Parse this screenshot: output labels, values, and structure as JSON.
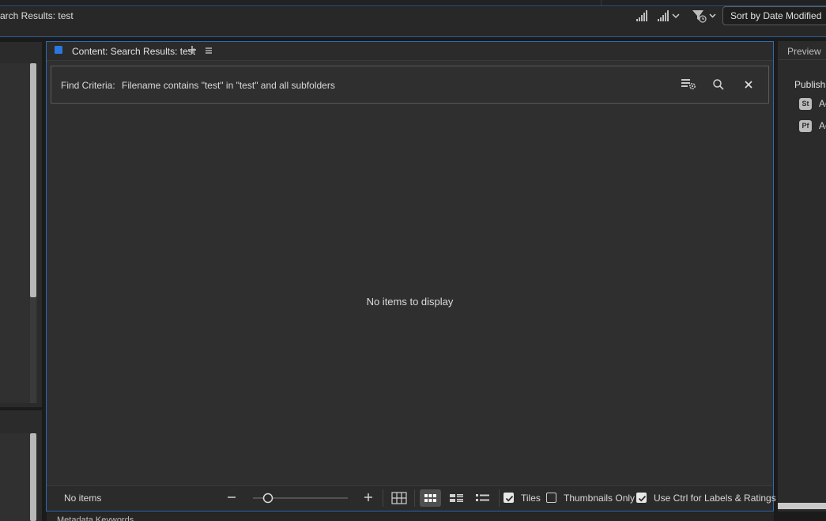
{
  "path_bar": {
    "path_text": "arch Results: test",
    "sort_label": "Sort by Date Modified",
    "icons": [
      "rating-filter-icon",
      "rating-filter-dropdown-icon",
      "filter-dropdown-icon"
    ]
  },
  "content_panel": {
    "title": "Content: Search Results: test",
    "find": {
      "label": "Find Criteria:",
      "value": "Filename contains \"test\" in \"test\" and all subfolders"
    },
    "empty_message": "No items to display",
    "status": {
      "count": "No items",
      "tiles_label": "Tiles",
      "tiles_checked": true,
      "thumbs_only_label": "Thumbnails Only",
      "thumbs_only_checked": false,
      "ctrl_label": "Use Ctrl for Labels & Ratings",
      "ctrl_checked": true
    },
    "accent": "#2a77e0"
  },
  "bottom_panel": {
    "title_fragment": "Metadata   Keywords"
  },
  "right_panel": {
    "tab": "Preview",
    "publish_heading": "Publish",
    "services": [
      {
        "badge": "St",
        "label": "Ac"
      },
      {
        "badge": "Pf",
        "label": "Ac"
      }
    ]
  }
}
